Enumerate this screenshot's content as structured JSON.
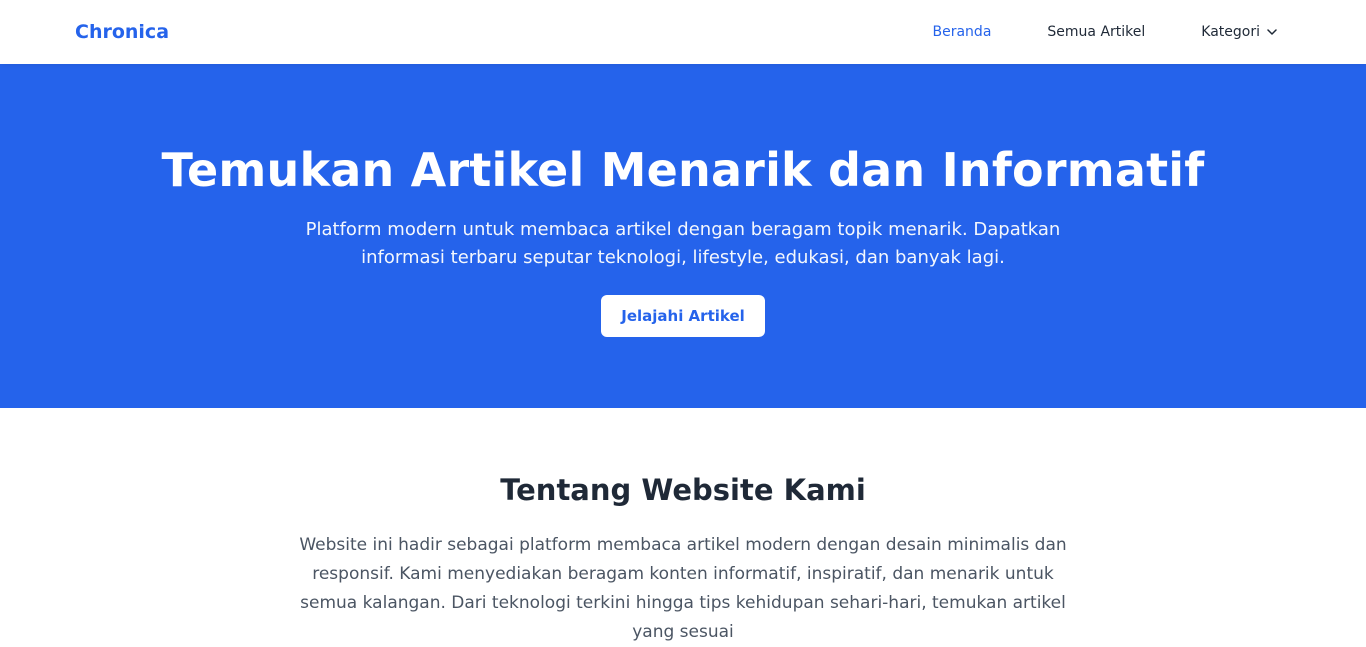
{
  "navbar": {
    "brand": "Chronica",
    "links": [
      {
        "label": "Beranda",
        "active": true
      },
      {
        "label": "Semua Artikel",
        "active": false
      },
      {
        "label": "Kategori",
        "active": false,
        "icon": "chevron-down-icon"
      }
    ]
  },
  "hero": {
    "title": "Temukan Artikel Menarik dan Informatif",
    "subtitle": "Platform modern untuk membaca artikel dengan beragam topik menarik. Dapatkan informasi terbaru seputar teknologi, lifestyle, edukasi, dan banyak lagi.",
    "cta_label": "Jelajahi Artikel"
  },
  "about": {
    "title": "Tentang Website Kami",
    "text": "Website ini hadir sebagai platform membaca artikel modern dengan desain minimalis dan responsif. Kami menyediakan beragam konten informatif, inspiratif, dan menarik untuk semua kalangan. Dari teknologi terkini hingga tips kehidupan sehari-hari, temukan artikel yang sesuai"
  },
  "colors": {
    "accent": "#2563eb",
    "text_dark": "#1f2937",
    "text_muted": "#4b5563",
    "background": "#ffffff"
  }
}
